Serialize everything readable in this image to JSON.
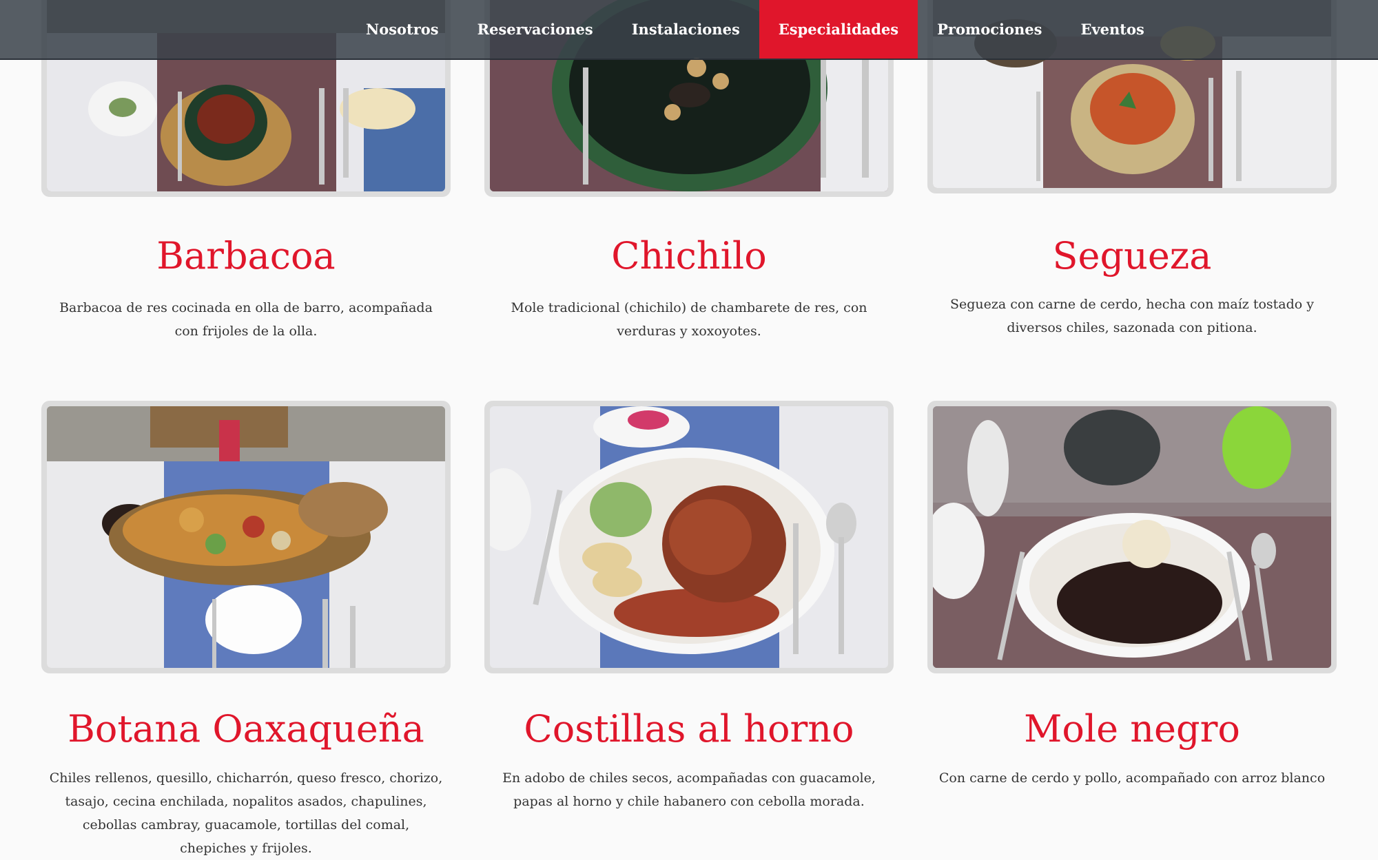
{
  "nav": {
    "items": [
      {
        "label": "Nosotros"
      },
      {
        "label": "Reservaciones"
      },
      {
        "label": "Instalaciones"
      },
      {
        "label": "Especialidades"
      },
      {
        "label": "Promociones"
      },
      {
        "label": "Eventos"
      }
    ],
    "active_index": 3
  },
  "colors": {
    "accent": "#e0162b",
    "nav_bg": "#3a424a",
    "text": "#333333"
  },
  "dishes": [
    {
      "title": "Barbacoa",
      "desc": "Barbacoa de res cocinada en olla de barro, acompañada con frijoles de la olla."
    },
    {
      "title": "Chichilo",
      "desc": "Mole tradicional (chichilo) de chambarete de res, con verduras y xoxoyotes."
    },
    {
      "title": "Segueza",
      "desc": "Segueza con carne de cerdo, hecha con maíz tostado y diversos chiles, sazonada con pitiona."
    },
    {
      "title": "Botana Oaxaqueña",
      "desc": "Chiles rellenos, quesillo, chicharrón, queso fresco, chorizo, tasajo, cecina enchilada, nopalitos asados, chapulines, cebollas cambray, guacamole, tortillas del comal, chepiches y frijoles."
    },
    {
      "title": "Costillas al horno",
      "desc": "En adobo de chiles secos, acompañadas con guacamole, papas al horno y chile habanero con cebolla morada."
    },
    {
      "title": "Mole negro",
      "desc": "Con carne de cerdo y pollo, acompañado con arroz blanco"
    }
  ]
}
